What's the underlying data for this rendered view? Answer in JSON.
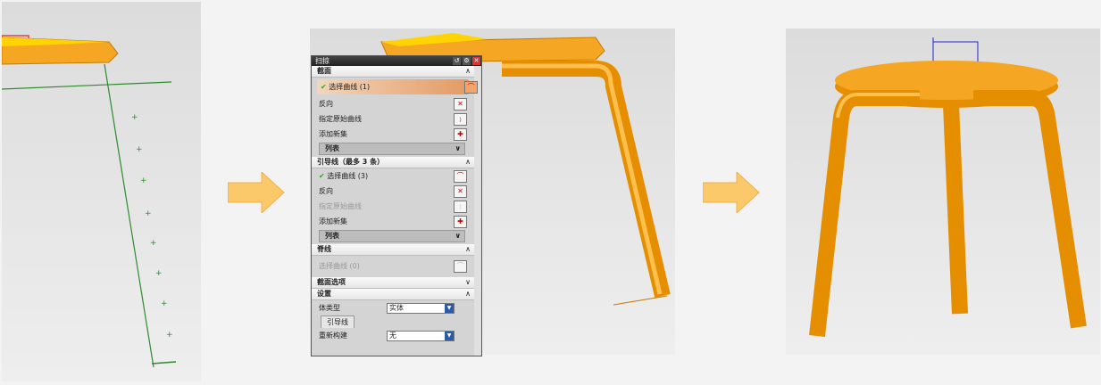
{
  "dialog": {
    "title": "扫掠",
    "sections": {
      "section": {
        "title": "截面",
        "select_curve": "选择曲线 (1)",
        "reverse": "反向",
        "specify_origin": "指定原始曲线",
        "add_new_set": "添加新集",
        "list": "列表"
      },
      "guide": {
        "title": "引导线（最多 3 条）",
        "select_curve": "选择曲线 (3)",
        "reverse": "反向",
        "specify_origin": "指定原始曲线",
        "add_new_set": "添加新集",
        "list": "列表"
      },
      "spine": {
        "title": "脊线",
        "select_curve": "选择曲线 (0)"
      },
      "section_options": {
        "title": "截面选项"
      },
      "settings": {
        "title": "设置",
        "body_type_label": "体类型",
        "body_type_value": "实体",
        "tab": "引导线",
        "rebuild_label": "重新构建",
        "rebuild_value": "无"
      }
    }
  },
  "colors": {
    "part": "#f5a623",
    "curve": "#2e8b2e",
    "arrow": "#fbc86a"
  }
}
